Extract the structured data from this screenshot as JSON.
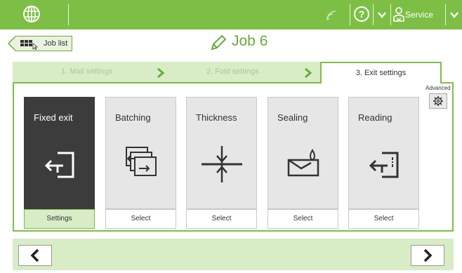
{
  "colors": {
    "accent": "#7dbf45",
    "accent_light": "#d8ecc6",
    "selected_card": "#3c3c3c",
    "card_bg": "#e6e6e6"
  },
  "topbar": {
    "icons": [
      "globe-icon",
      "signal-icon",
      "help-icon",
      "chevron-down-icon",
      "user-service-icon",
      "chevron-down-icon"
    ],
    "service_label": "Service"
  },
  "header": {
    "back_button_label": "Job list",
    "title": "Job 6"
  },
  "tabs": [
    {
      "label": "1. Mail settings",
      "active": false
    },
    {
      "label": "2. Fold settings",
      "active": false
    },
    {
      "label": "3. Exit settings",
      "active": true
    }
  ],
  "advanced_label": "Advanced",
  "cards": [
    {
      "title": "Fixed exit",
      "button": "Settings",
      "selected": true,
      "icon": "exit-icon"
    },
    {
      "title": "Batching",
      "button": "Select",
      "selected": false,
      "icon": "batching-icon"
    },
    {
      "title": "Thickness",
      "button": "Select",
      "selected": false,
      "icon": "thickness-icon"
    },
    {
      "title": "Sealing",
      "button": "Select",
      "selected": false,
      "icon": "sealing-icon"
    },
    {
      "title": "Reading",
      "button": "Select",
      "selected": false,
      "icon": "reading-icon"
    }
  ],
  "bottom": {
    "prev_icon": "chevron-left-icon",
    "next_icon": "chevron-right-icon"
  }
}
